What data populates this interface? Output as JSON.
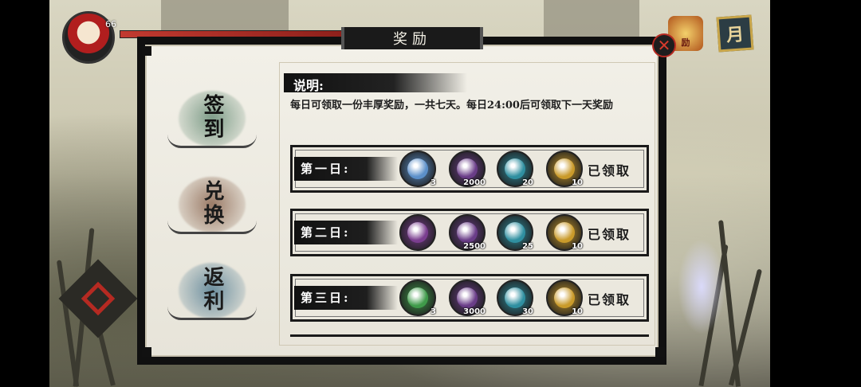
{
  "hud": {
    "level": "66"
  },
  "top_buttons": {
    "reward_label": "励",
    "month_label": "月"
  },
  "dialog": {
    "title": "奖励",
    "close_symbol": "✕",
    "tabs": [
      {
        "label": "签到",
        "color": "#6f8f7a"
      },
      {
        "label": "兑换",
        "color": "#8a6a58"
      },
      {
        "label": "返利",
        "color": "#5f7f8f"
      }
    ],
    "description": {
      "label": "说明:",
      "text": "每日可领取一份丰厚奖励，一共七天。每日24:00后可领取下一天奖励"
    },
    "days": [
      {
        "label": "第一日:",
        "status": "已领取",
        "items": [
          {
            "name": "pill-bag-icon",
            "count": "3",
            "color": "#5b8fc9"
          },
          {
            "name": "coin-icon",
            "count": "2000",
            "color": "#6a3d88"
          },
          {
            "name": "blue-flame-icon",
            "count": "20",
            "color": "#2f8fa0"
          },
          {
            "name": "gold-ingot-icon",
            "count": "10",
            "color": "#c99a2a"
          }
        ]
      },
      {
        "label": "第二日:",
        "status": "已领取",
        "items": [
          {
            "name": "weapon-icon",
            "count": "",
            "color": "#7a3d8f"
          },
          {
            "name": "coin-icon",
            "count": "2500",
            "color": "#6a3d88"
          },
          {
            "name": "blue-flame-icon",
            "count": "25",
            "color": "#2f8fa0"
          },
          {
            "name": "gold-ingot-icon",
            "count": "10",
            "color": "#c99a2a"
          }
        ]
      },
      {
        "label": "第三日:",
        "status": "已领取",
        "items": [
          {
            "name": "green-potion-icon",
            "count": "3",
            "color": "#3f9a4a"
          },
          {
            "name": "coin-icon",
            "count": "3000",
            "color": "#6a3d88"
          },
          {
            "name": "blue-flame-icon",
            "count": "30",
            "color": "#2f8fa0"
          },
          {
            "name": "gold-ingot-icon",
            "count": "10",
            "color": "#c99a2a"
          }
        ]
      }
    ]
  }
}
